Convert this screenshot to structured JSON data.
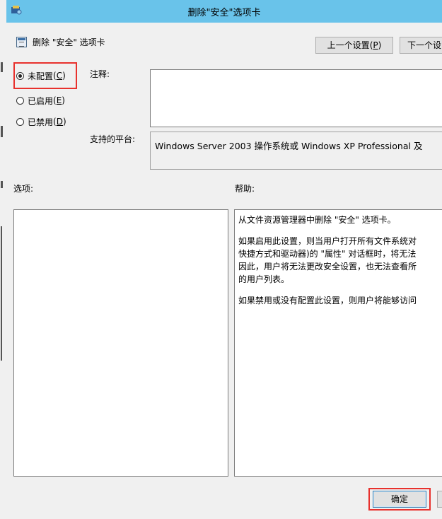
{
  "window": {
    "title": "删除\"安全\"选项卡"
  },
  "header": {
    "title": "删除 \"安全\" 选项卡"
  },
  "nav": {
    "prev": {
      "label": "上一个设置",
      "key": "P"
    },
    "next": {
      "label": "下一个设"
    }
  },
  "state": {
    "options": [
      {
        "label": "未配置",
        "key": "C",
        "checked": true
      },
      {
        "label": "已启用",
        "key": "E",
        "checked": false
      },
      {
        "label": "已禁用",
        "key": "D",
        "checked": false
      }
    ]
  },
  "comment": {
    "label": "注释:",
    "value": ""
  },
  "platform": {
    "label": "支持的平台:",
    "value": "Windows Server 2003 操作系统或 Windows XP Professional 及"
  },
  "options_panel": {
    "label": "选项:"
  },
  "help_panel": {
    "label": "帮助:",
    "paragraphs": [
      [
        "从文件资源管理器中删除 \"安全\" 选项卡。"
      ],
      [
        "如果启用此设置，则当用户打开所有文件系统对",
        "快捷方式和驱动器)的 \"属性\" 对话框时，将无法",
        "因此，用户将无法更改安全设置，也无法查看所",
        "的用户列表。"
      ],
      [
        "如果禁用或没有配置此设置，则用户将能够访问"
      ]
    ]
  },
  "footer": {
    "ok": "确定"
  },
  "colors": {
    "titlebar": "#69c3ea",
    "highlight_box": "#e8312d"
  }
}
